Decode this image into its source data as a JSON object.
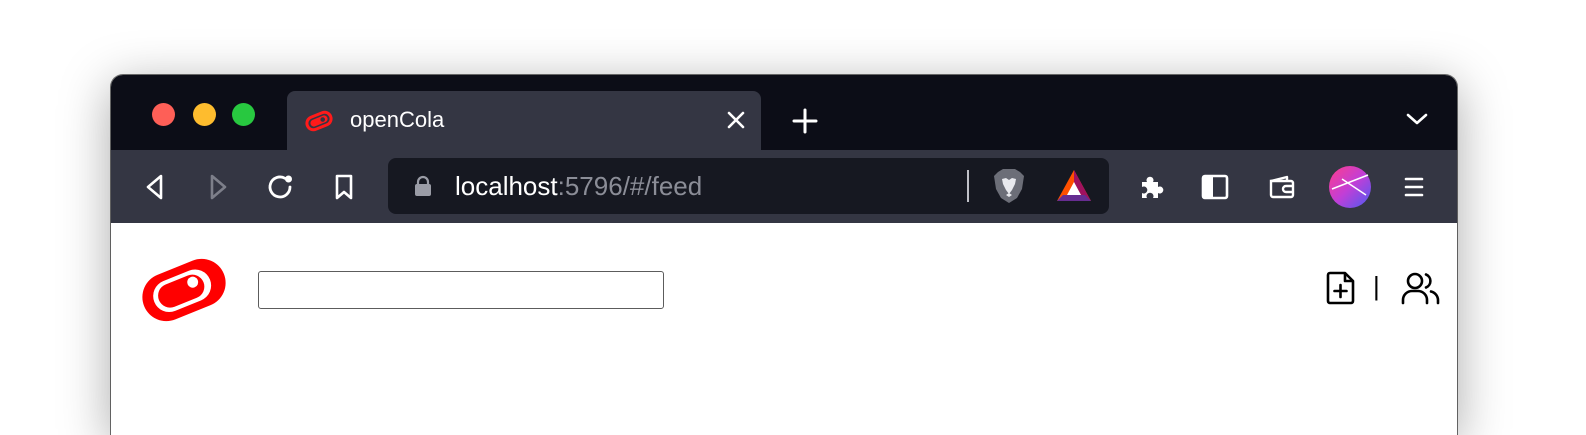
{
  "browser": {
    "tab": {
      "title": "openCola",
      "favicon": "opencola-logo-icon"
    },
    "address_bar": {
      "host": "localhost",
      "path": ":5796/#/feed"
    },
    "icons": {
      "back": "back-arrow-icon",
      "forward": "forward-arrow-icon",
      "reload": "reload-icon",
      "bookmark": "bookmark-icon",
      "lock": "lock-icon",
      "brave_shields": "brave-lion-icon",
      "brave_rewards": "bat-triangle-icon",
      "extensions": "puzzle-piece-icon",
      "sidebar": "sidebar-icon",
      "wallet": "wallet-icon",
      "profile": "profile-avatar-icon",
      "menu": "hamburger-menu-icon"
    },
    "colors": {
      "titlebar": "#0c0d17",
      "toolbar": "#343643",
      "urlbar": "#161821"
    }
  },
  "page": {
    "search": {
      "value": "",
      "placeholder": ""
    },
    "nav": {
      "divider": "|",
      "new_post_icon": "file-plus-icon",
      "personas_icon": "users-icon"
    },
    "colors": {
      "brand": "#ff0000"
    }
  }
}
